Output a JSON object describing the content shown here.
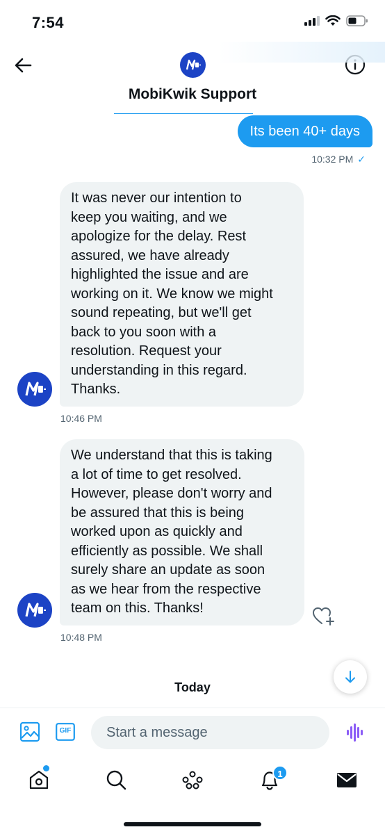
{
  "status_bar": {
    "time": "7:54"
  },
  "header": {
    "title": "MobiKwik Support",
    "logo_letter": "M"
  },
  "conversation": {
    "sent": {
      "text": "Its been 40+ days",
      "time": "10:32 PM",
      "read_mark": "✓"
    },
    "received": [
      {
        "text": "It was never our intention to\nkeep you waiting, and we\napologize for the delay. Rest\nassured, we have already\nhighlighted the issue and are\nworking on it. We know we might\nsound repeating, but we'll get\nback to you soon with a\nresolution. Request your\nunderstanding in this regard.\nThanks.",
        "time": "10:46 PM"
      },
      {
        "text": "We understand that this is taking\na lot of time to get resolved.\nHowever, please don't worry and\nbe assured that this is being\nworked upon as quickly and\nefficiently as possible. We shall\nsurely share an update as soon\nas we hear from the respective\nteam on this. Thanks!",
        "time": "10:48 PM"
      }
    ],
    "date_divider": "Today"
  },
  "composer": {
    "placeholder": "Start a message",
    "gif_label": "GIF"
  },
  "nav": {
    "items": [
      "home-icon",
      "search-icon",
      "spaces-icon",
      "notifications-icon",
      "messages-icon"
    ],
    "notification_count": "1"
  },
  "colors": {
    "accent": "#1d9bf0",
    "brand": "#1c43c5",
    "bubble_gray": "#eff3f4",
    "voice": "#8b5cf6"
  }
}
